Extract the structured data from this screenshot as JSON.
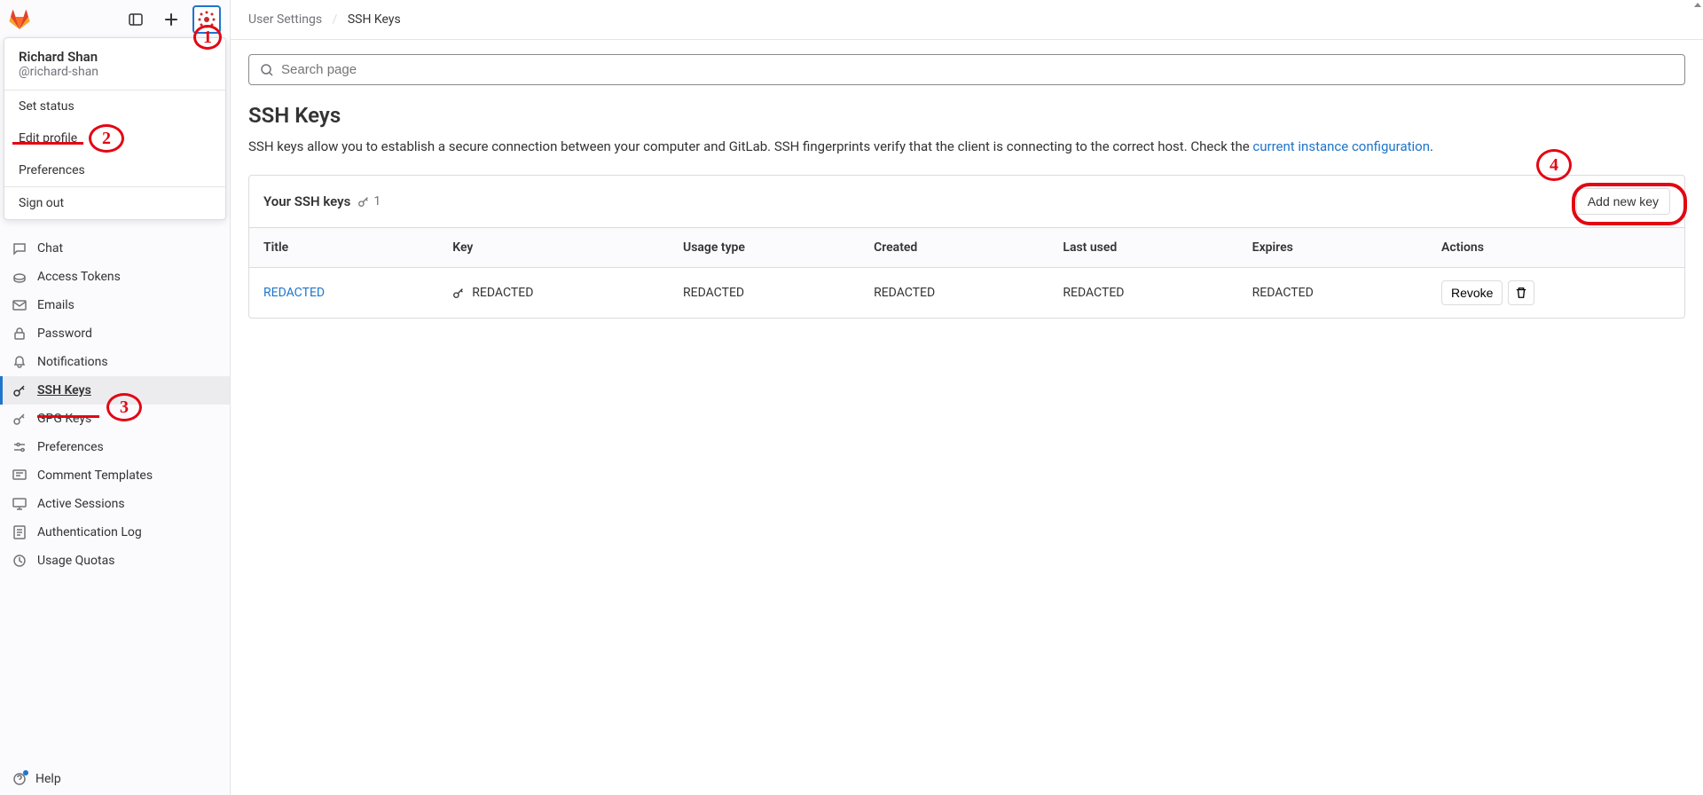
{
  "breadcrumb": {
    "parent": "User Settings",
    "current": "SSH Keys"
  },
  "search": {
    "placeholder": "Search page"
  },
  "page": {
    "title": "SSH Keys",
    "desc_prefix": "SSH keys allow you to establish a secure connection between your computer and GitLab. SSH fingerprints verify that the client is connecting to the correct host. Check the ",
    "desc_link": "current instance configuration",
    "desc_suffix": "."
  },
  "panel": {
    "title": "Your SSH keys",
    "count": "1",
    "add_button": "Add new key"
  },
  "table": {
    "headers": {
      "title": "Title",
      "key": "Key",
      "usage": "Usage type",
      "created": "Created",
      "last_used": "Last used",
      "expires": "Expires",
      "actions": "Actions"
    },
    "rows": [
      {
        "title": "REDACTED",
        "key": "REDACTED",
        "usage": "REDACTED",
        "created": "REDACTED",
        "last_used": "REDACTED",
        "expires": "REDACTED",
        "revoke": "Revoke"
      }
    ]
  },
  "user": {
    "name": "Richard Shan",
    "handle": "@richard-shan"
  },
  "dropdown": {
    "set_status": "Set status",
    "edit_profile": "Edit profile",
    "preferences": "Preferences",
    "sign_out": "Sign out"
  },
  "sidebar": {
    "items": [
      {
        "label": "Chat"
      },
      {
        "label": "Access Tokens"
      },
      {
        "label": "Emails"
      },
      {
        "label": "Password"
      },
      {
        "label": "Notifications"
      },
      {
        "label": "SSH Keys"
      },
      {
        "label": "GPG Keys"
      },
      {
        "label": "Preferences"
      },
      {
        "label": "Comment Templates"
      },
      {
        "label": "Active Sessions"
      },
      {
        "label": "Authentication Log"
      },
      {
        "label": "Usage Quotas"
      }
    ],
    "help": "Help"
  },
  "annotations": {
    "a1": "1",
    "a2": "2",
    "a3": "3",
    "a4": "4"
  }
}
